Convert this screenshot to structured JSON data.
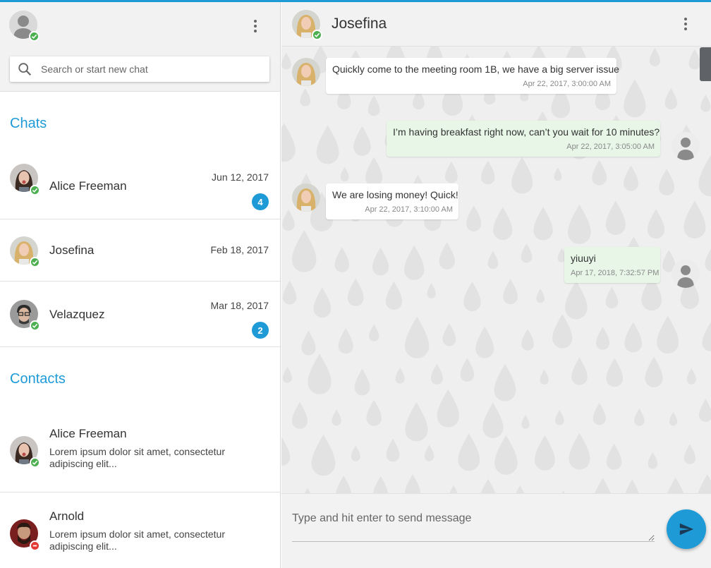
{
  "colors": {
    "accent": "#1e9bd7",
    "online": "#4caf50",
    "busy": "#e53935",
    "outgoing_bubble": "#e7f6e7"
  },
  "sidebar": {
    "search": {
      "placeholder": "Search or start new chat",
      "icon": "search-icon"
    },
    "chats_title": "Chats",
    "chats": [
      {
        "name": "Alice Freeman",
        "date": "Jun 12, 2017",
        "unread": "4",
        "status": "online"
      },
      {
        "name": "Josefina",
        "date": "Feb 18, 2017",
        "unread": null,
        "status": "online"
      },
      {
        "name": "Velazquez",
        "date": "Mar 18, 2017",
        "unread": "2",
        "status": "online"
      }
    ],
    "contacts_title": "Contacts",
    "contacts": [
      {
        "name": "Alice Freeman",
        "preview": "Lorem ipsum dolor sit amet, consectetur adipiscing elit...",
        "status": "online"
      },
      {
        "name": "Arnold",
        "preview": "Lorem ipsum dolor sit amet, consectetur adipiscing elit...",
        "status": "busy"
      }
    ]
  },
  "conversation": {
    "contact_name": "Josefina",
    "messages": [
      {
        "direction": "in",
        "text": "Quickly come to the meeting room 1B, we have a big server issue",
        "time": "Apr 22, 2017, 3:00:00 AM"
      },
      {
        "direction": "out",
        "text": "I’m having breakfast right now, can’t you wait for 10 minutes?",
        "time": "Apr 22, 2017, 3:05:00 AM"
      },
      {
        "direction": "in",
        "text": "We are losing money! Quick!",
        "time": "Apr 22, 2017, 3:10:00 AM"
      },
      {
        "direction": "out",
        "text": "yiuuyi",
        "time": "Apr 17, 2018, 7:32:57 PM"
      }
    ],
    "composer": {
      "placeholder": "Type and hit enter to send message",
      "value": ""
    }
  }
}
